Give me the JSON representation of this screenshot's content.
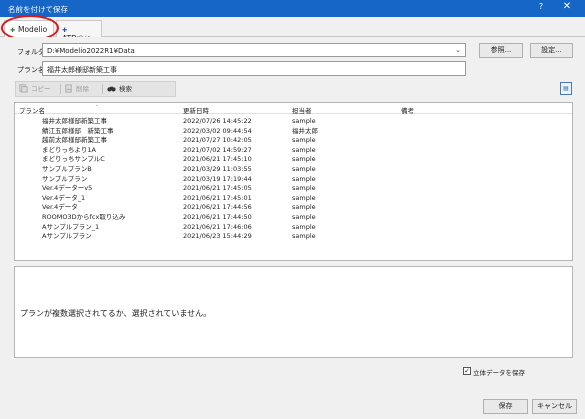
{
  "window": {
    "title": "名前を付けて保存",
    "help_label": "?",
    "close_label": "✕"
  },
  "tabs": [
    {
      "label": "Modelio",
      "icon": "modelio-icon",
      "active": true
    },
    {
      "label": "ATDrive",
      "icon": "atdrive-icon",
      "active": false
    }
  ],
  "folder": {
    "label": "フォルダ",
    "value": "D:¥Modelio2022R1¥Data",
    "browse_label": "参照...",
    "settings_label": "設定..."
  },
  "plan_name": {
    "label": "プラン名",
    "value": "福井太郎様邸新築工事"
  },
  "toolbar": {
    "items": [
      {
        "label": "コピー",
        "icon": "copy-icon",
        "enabled": false
      },
      {
        "label": "削除",
        "icon": "delete-icon",
        "enabled": false
      },
      {
        "label": "検索",
        "icon": "binoculars-icon",
        "enabled": true
      }
    ],
    "view_icon": "list-view-icon"
  },
  "list": {
    "columns": [
      "プラン名",
      "更新日時",
      "担当者",
      "備考"
    ],
    "rows": [
      {
        "name": "福井太郎様邸新築工事",
        "date": "2022/07/26 14:45:22",
        "owner": "sample",
        "note": ""
      },
      {
        "name": "鯖江五郎様邸　新築工事",
        "date": "2022/03/02 09:44:54",
        "owner": "福井太郎",
        "note": ""
      },
      {
        "name": "越前太郎様邸新築工事",
        "date": "2021/07/27 10:42:05",
        "owner": "sample",
        "note": ""
      },
      {
        "name": "まどりっちより1A",
        "date": "2021/07/02 14:59:27",
        "owner": "sample",
        "note": ""
      },
      {
        "name": "まどりっちサンプルC",
        "date": "2021/06/21 17:45:10",
        "owner": "sample",
        "note": ""
      },
      {
        "name": "サンプルプランB",
        "date": "2021/03/29 11:03:55",
        "owner": "sample",
        "note": ""
      },
      {
        "name": "サンプルプラン",
        "date": "2021/03/19 17:19:44",
        "owner": "sample",
        "note": ""
      },
      {
        "name": "Ver.4データーv5",
        "date": "2021/06/21 17:45:05",
        "owner": "sample",
        "note": ""
      },
      {
        "name": "Ver.4データ_1",
        "date": "2021/06/21 17:45:01",
        "owner": "sample",
        "note": ""
      },
      {
        "name": "Ver.4データ",
        "date": "2021/06/21 17:44:56",
        "owner": "sample",
        "note": ""
      },
      {
        "name": "ROOMO3Dからfcx取り込み",
        "date": "2021/06/21 17:44:50",
        "owner": "sample",
        "note": ""
      },
      {
        "name": "Aサンプルプラン_1",
        "date": "2021/06/21 17:46:06",
        "owner": "sample",
        "note": ""
      },
      {
        "name": "Aサンプルプラン",
        "date": "2021/06/23 15:44:29",
        "owner": "sample",
        "note": ""
      }
    ]
  },
  "message": "プランが複数選択されてるか、選択されていません。",
  "save_3d": {
    "label": "立体データを保存",
    "checked": true
  },
  "buttons": {
    "save_label": "保存",
    "cancel_label": "キャンセル"
  },
  "colors": {
    "titlebar": "#1566c7",
    "highlight_ring": "#d71a1a",
    "accent": "#4a78c0"
  }
}
